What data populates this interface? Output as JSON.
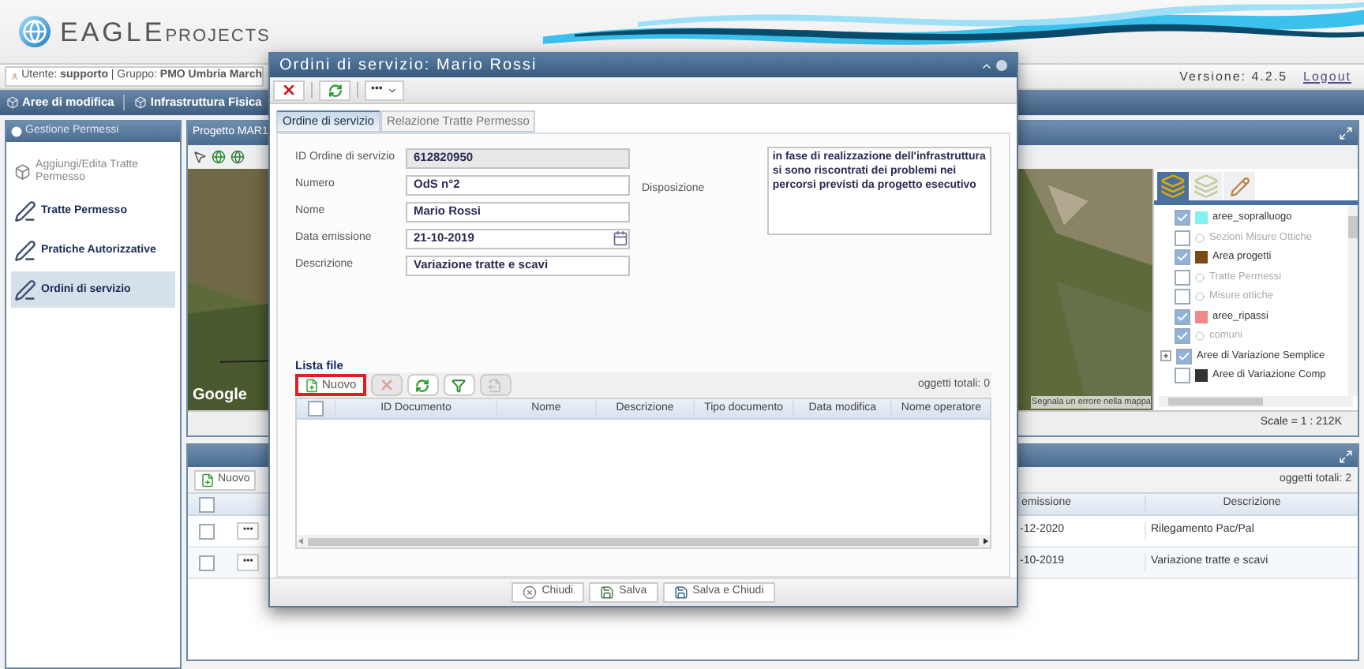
{
  "header": {
    "logo_primary": "EAGLE",
    "logo_secondary": "PROJECTS"
  },
  "user_bar": {
    "user": "Utente: **supporto** | Gruppo: **PMO Umbria March**",
    "version": "Versione: 4.2.5",
    "logout": "Logout"
  },
  "nav": [
    "Aree di modifica",
    "Infrastruttura Fisica"
  ],
  "sidebar": {
    "title": "Gestione Permessi",
    "items": [
      {
        "label": "Aggiungi/Edita Tratte Permesso",
        "disabled": true,
        "selected": false
      },
      {
        "label": "Tratte Permesso",
        "disabled": false,
        "selected": false
      },
      {
        "label": "Pratiche Autorizzative",
        "disabled": false,
        "selected": false
      },
      {
        "label": "Ordini di servizio",
        "disabled": false,
        "selected": true
      }
    ]
  },
  "map_panel": {
    "title": "Progetto MAR1",
    "attribution": "Google",
    "report_link": "Segnala un errore nella mappa",
    "scale": "Scale = 1 : 212K",
    "layer_tabs": [
      {
        "kind": "layers",
        "selected": true
      },
      {
        "kind": "base",
        "selected": false
      },
      {
        "kind": "edit",
        "selected": false
      }
    ],
    "layers": [
      {
        "kind": "layer",
        "label": "aree_sopralluogo",
        "checked": true,
        "disabled": false,
        "color": "#80f0f0"
      },
      {
        "kind": "layer",
        "label": "Sezioni Misure Ottiche",
        "checked": false,
        "disabled": true
      },
      {
        "kind": "layer",
        "label": "Area progetti",
        "checked": true,
        "disabled": false,
        "color": "#7a4a12"
      },
      {
        "kind": "layer",
        "label": "Tratte Permessi",
        "checked": false,
        "disabled": true
      },
      {
        "kind": "layer",
        "label": "Misure ottiche",
        "checked": false,
        "disabled": true
      },
      {
        "kind": "layer",
        "label": "aree_ripassi",
        "checked": true,
        "disabled": false,
        "color": "#f08a8a"
      },
      {
        "kind": "layer",
        "label": "comuni",
        "checked": true,
        "disabled": true
      },
      {
        "kind": "group",
        "label": "Aree di Variazione Semplice",
        "checked": true,
        "disabled": false,
        "expanded": false
      },
      {
        "kind": "layer",
        "label": "Aree di Variazione Comp",
        "checked": false,
        "disabled": false,
        "color": "#333333"
      }
    ]
  },
  "grid": {
    "all_checked": false,
    "new_button": "Nuovo",
    "total": "oggetti totali: 2",
    "columns": [
      "emissione",
      "Descrizione"
    ],
    "rows": [
      {
        "checked": false,
        "actions": "•••",
        "cells": [
          "-12-2020",
          "Rilegamento Pac/Pal"
        ]
      },
      {
        "checked": false,
        "actions": "•••",
        "cells": [
          "-10-2019",
          "Variazione tratte e scavi"
        ]
      }
    ]
  },
  "dialog": {
    "title": "Ordini di servizio: Mario Rossi",
    "more": "•••",
    "tabs": [
      {
        "label": "Ordine di servizio",
        "selected": true
      },
      {
        "label": "Relazione Tratte Permesso",
        "selected": false
      }
    ],
    "fields": [
      {
        "label": "ID Ordine di servizio",
        "value": "612820950",
        "kind": "readonly"
      },
      {
        "label": "Numero",
        "value": "OdS n°2",
        "kind": "text"
      },
      {
        "label": "Nome",
        "value": "Mario Rossi",
        "kind": "text"
      },
      {
        "label": "Data emissione",
        "value": "21-10-2019",
        "kind": "date"
      },
      {
        "label": "Descrizione",
        "value": "Variazione tratte e scavi",
        "kind": "text"
      }
    ],
    "disposition": {
      "label": "Disposizione",
      "value": "in fase di realizzazione dell'infrastruttura si sono riscontrati dei problemi nei percorsi previsti da progetto esecutivo"
    },
    "files": {
      "title": "Lista file",
      "new_button": {
        "label": "Nuovo",
        "highlighted": true
      },
      "tools": [
        {
          "kind": "delete",
          "disabled": true
        },
        {
          "kind": "refresh",
          "disabled": false
        },
        {
          "kind": "filter",
          "disabled": false
        },
        {
          "kind": "export",
          "disabled": true
        }
      ],
      "total": "oggetti totali: 0",
      "all_checked": false,
      "columns": [
        "ID Documento",
        "Nome",
        "Descrizione",
        "Tipo documento",
        "Data modifica",
        "Nome operatore"
      ]
    },
    "buttons": [
      {
        "kind": "close",
        "label": "Chiudi"
      },
      {
        "kind": "save",
        "label": "Salva"
      },
      {
        "kind": "save_close",
        "label": "Salva e Chiudi"
      }
    ]
  }
}
